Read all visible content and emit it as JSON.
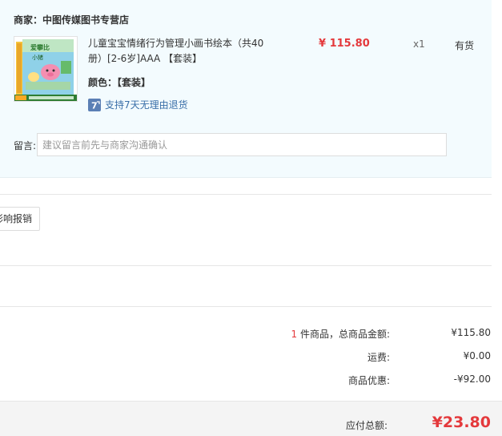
{
  "store": {
    "label": "商家：",
    "name": "中图传媒图书专营店"
  },
  "product": {
    "title": "儿童宝宝情绪行为管理小画书绘本（共40册）[2-6岁]AAA 【套装】",
    "variant": "颜色：【套装】",
    "return_policy": "支持7天无理由退货",
    "return_icon": "seven-day-return-icon",
    "price": "¥ 115.80",
    "quantity": "x1",
    "stock": "有货"
  },
  "remark": {
    "label": "留言:",
    "placeholder": "建议留言前先与商家沟通确认"
  },
  "partial_button": {
    "label": "影响报销"
  },
  "summary": {
    "count": "1",
    "count_suffix": " 件商品，总商品金额:",
    "goods_amount": "¥115.80",
    "shipping_label": "运费:",
    "shipping_value": "¥0.00",
    "discount_label": "商品优惠:",
    "discount_value": "-¥92.00",
    "total_label": "应付总额:",
    "total_value": "¥23.80"
  },
  "colors": {
    "accent_red": "#e4393c",
    "link_blue": "#3a6fa8",
    "store_bg": "#f3fbfe",
    "total_bg": "#f4f4f4"
  }
}
